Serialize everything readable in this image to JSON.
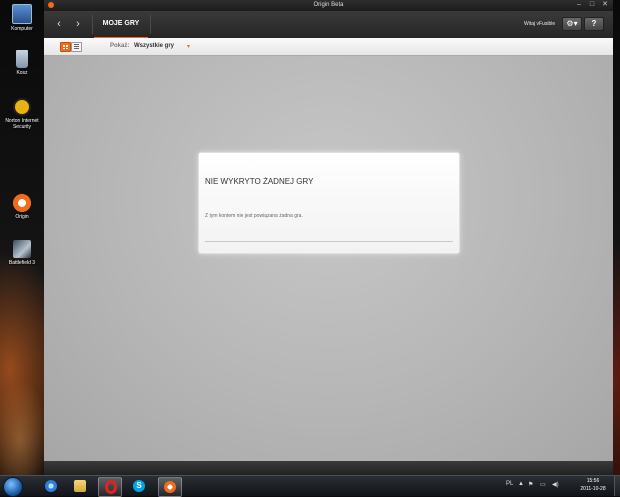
{
  "desktop": {
    "icons": [
      {
        "label": "Komputer",
        "icon": "computer-icon"
      },
      {
        "label": "Kosz",
        "icon": "recycle-bin-icon"
      },
      {
        "label": "Norton Internet Security",
        "icon": "norton-icon"
      },
      {
        "label": "Origin",
        "icon": "origin-icon"
      },
      {
        "label": "Battlefield 3",
        "icon": "battlefield-icon"
      }
    ]
  },
  "window": {
    "title": "Origin Beta",
    "controls": {
      "minimize": "–",
      "maximize": "□",
      "close": "✕"
    },
    "nav": {
      "back": "‹",
      "forward": "›",
      "tab_label": "MOJE GRY",
      "sign_in": "Witaj vFusible",
      "gear": "⚙▾",
      "help": "?"
    },
    "filter": {
      "show_label": "Pokaż:",
      "show_value": "Wszystkie gry",
      "dropdown_arrow": "▾"
    },
    "dialog": {
      "title": "NIE WYKRYTO ŻADNEJ GRY",
      "message": "Z tym kontem nie jest powiązana żadna gra."
    }
  },
  "taskbar": {
    "apps": [
      "internet-explorer-icon",
      "folder-icon",
      "opera-icon",
      "skype-icon",
      "origin-icon"
    ],
    "tray": {
      "lang": "PL",
      "arrow": "▲",
      "flag": "⚑",
      "network": "▭",
      "volume": "◀)"
    },
    "clock": {
      "time": "15:56",
      "date": "2011-10-28"
    }
  },
  "colors": {
    "accent": "#f06b1c",
    "content_bg": "#bdbdbd",
    "titlebar": "#262626"
  }
}
